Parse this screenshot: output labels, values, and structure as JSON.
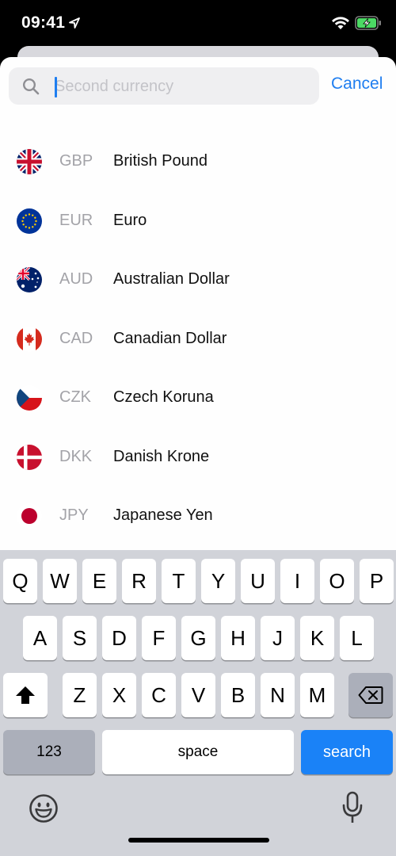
{
  "status": {
    "time": "09:41"
  },
  "search": {
    "placeholder": "Second currency",
    "value": "",
    "cancel_label": "Cancel"
  },
  "currencies": [
    {
      "code": "GBP",
      "name": "British Pound",
      "flag": "uk-flag-icon"
    },
    {
      "code": "EUR",
      "name": "Euro",
      "flag": "eu-flag-icon"
    },
    {
      "code": "AUD",
      "name": "Australian Dollar",
      "flag": "australia-flag-icon"
    },
    {
      "code": "CAD",
      "name": "Canadian Dollar",
      "flag": "canada-flag-icon"
    },
    {
      "code": "CZK",
      "name": "Czech Koruna",
      "flag": "czech-flag-icon"
    },
    {
      "code": "DKK",
      "name": "Danish Krone",
      "flag": "denmark-flag-icon"
    },
    {
      "code": "JPY",
      "name": "Japanese Yen",
      "flag": "japan-flag-icon"
    }
  ],
  "keyboard": {
    "row1": [
      "Q",
      "W",
      "E",
      "R",
      "T",
      "Y",
      "U",
      "I",
      "O",
      "P"
    ],
    "row2": [
      "A",
      "S",
      "D",
      "F",
      "G",
      "H",
      "J",
      "K",
      "L"
    ],
    "row3": [
      "Z",
      "X",
      "C",
      "V",
      "B",
      "N",
      "M"
    ],
    "numbers_label": "123",
    "space_label": "space",
    "search_label": "search"
  },
  "colors": {
    "accent": "#1f7ef0",
    "search_key": "#1a82f7",
    "keyboard_bg": "#d1d3d9"
  }
}
